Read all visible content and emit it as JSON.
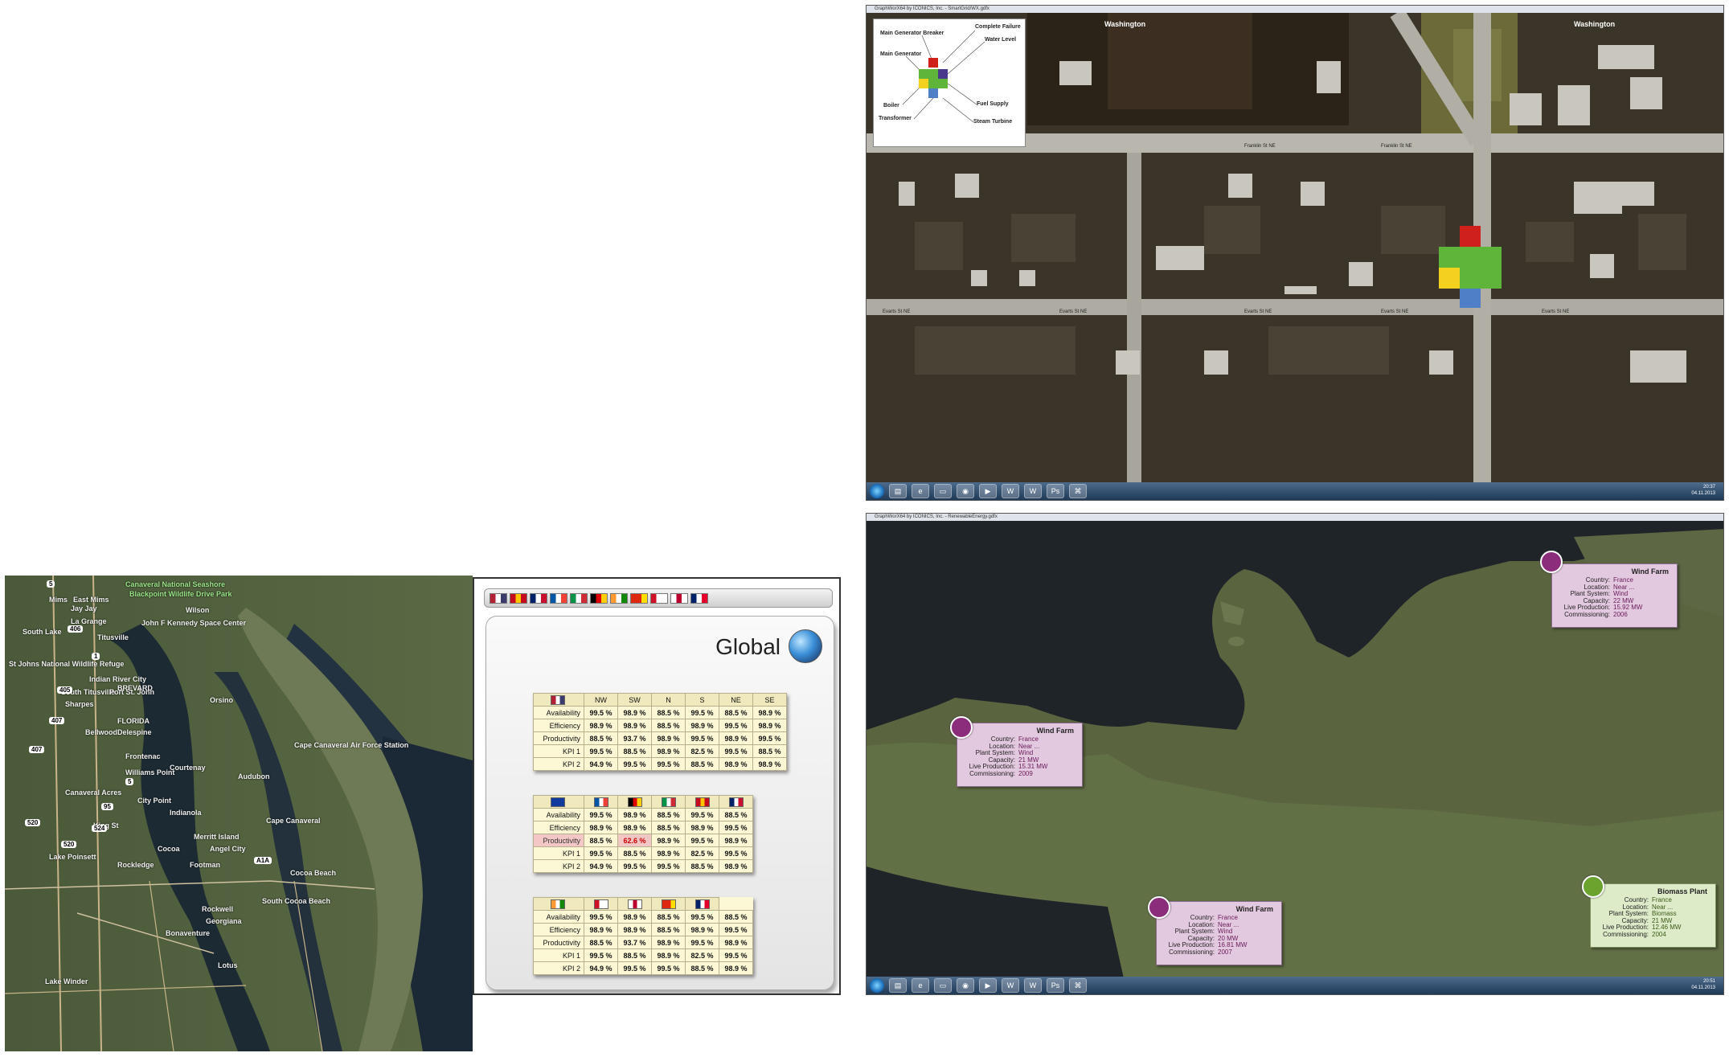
{
  "map_left": {
    "labels": [
      "Canaveral National Seashore",
      "Blackpoint Wildlife Drive Park",
      "John F Kennedy Space Center",
      "Titusville",
      "Mims",
      "East Mims",
      "Jay Jay",
      "La Grange",
      "South Lake",
      "St Johns National Wildlife Refuge",
      "Indian River City",
      "South Titusville",
      "Port St. John",
      "Sharpes",
      "Bellwood",
      "Delespine",
      "Frontenac",
      "Williams Point",
      "Courtenay",
      "Cape Canaveral Air Force Station",
      "Audubon",
      "Orsino",
      "Canaveral Acres",
      "City Point",
      "Indianola",
      "Cape Canaveral",
      "Merritt Island",
      "Angel City",
      "Cocoa",
      "Rockledge",
      "Lake Poinsett",
      "Footman",
      "Cocoa Beach",
      "South Cocoa Beach",
      "Rockwell",
      "Georgiana",
      "Bonaventure",
      "Lotus",
      "Lake Winder",
      "Wilson",
      "BREVARD",
      "FLORIDA",
      "King St"
    ],
    "shields": [
      "5",
      "406",
      "1",
      "405",
      "407",
      "407",
      "5",
      "95",
      "520",
      "524",
      "520",
      "A1A"
    ]
  },
  "dashboard": {
    "title": "Global",
    "flags": [
      {
        "name": "usa-flag",
        "colors": [
          "#b22234",
          "#ffffff",
          "#3c3b6e"
        ]
      },
      {
        "name": "spain-flag",
        "colors": [
          "#c60b1e",
          "#ffc400",
          "#c60b1e"
        ]
      },
      {
        "name": "uk-flag",
        "colors": [
          "#012169",
          "#ffffff",
          "#c8102e"
        ]
      },
      {
        "name": "france-flag",
        "colors": [
          "#0055a4",
          "#ffffff",
          "#ef4135"
        ]
      },
      {
        "name": "italy-flag",
        "colors": [
          "#009246",
          "#ffffff",
          "#ce2b37"
        ]
      },
      {
        "name": "germany-flag",
        "colors": [
          "#000000",
          "#dd0000",
          "#ffce00"
        ]
      },
      {
        "name": "india-flag",
        "colors": [
          "#ff9933",
          "#ffffff",
          "#138808"
        ]
      },
      {
        "name": "china-flag",
        "colors": [
          "#de2910",
          "#de2910",
          "#ffde00"
        ]
      },
      {
        "name": "indonesia-flag",
        "colors": [
          "#ce1126",
          "#ffffff",
          "#ffffff"
        ]
      },
      {
        "name": "japan-flag",
        "colors": [
          "#ffffff",
          "#bc002d",
          "#ffffff"
        ]
      },
      {
        "name": "australia-flag",
        "colors": [
          "#012169",
          "#ffffff",
          "#e4002b"
        ]
      }
    ],
    "tables": [
      {
        "header": [
          "NW",
          "SW",
          "N",
          "S",
          "NE",
          "SE"
        ],
        "header_flag": "usa-flag",
        "rows": [
          {
            "label": "Availability",
            "values": [
              "99.5 %",
              "98.9 %",
              "88.5 %",
              "99.5 %",
              "88.5 %",
              "98.9 %"
            ]
          },
          {
            "label": "Efficiency",
            "values": [
              "98.9 %",
              "98.9 %",
              "88.5 %",
              "98.9 %",
              "99.5 %",
              "98.9 %"
            ]
          },
          {
            "label": "Productivity",
            "values": [
              "88.5 %",
              "93.7 %",
              "98.9 %",
              "99.5 %",
              "98.9 %",
              "99.5 %"
            ]
          },
          {
            "label": "KPI 1",
            "values": [
              "99.5 %",
              "88.5 %",
              "98.9 %",
              "82.5 %",
              "99.5 %",
              "88.5 %"
            ]
          },
          {
            "label": "KPI 2",
            "values": [
              "94.9 %",
              "99.5 %",
              "99.5 %",
              "88.5 %",
              "98.9 %",
              "98.9 %"
            ]
          }
        ]
      },
      {
        "header_flags": [
          "eu-flag",
          "france-flag",
          "germany-flag",
          "italy-flag",
          "spain-flag",
          "uk-flag"
        ],
        "rows": [
          {
            "label": "Availability",
            "values": [
              "99.5 %",
              "98.9 %",
              "88.5 %",
              "99.5 %",
              "88.5 %"
            ]
          },
          {
            "label": "Efficiency",
            "values": [
              "98.9 %",
              "98.9 %",
              "88.5 %",
              "98.9 %",
              "99.5 %"
            ]
          },
          {
            "label": "Productivity",
            "values": [
              "88.5 %",
              "62.6 %",
              "98.9 %",
              "99.5 %",
              "98.9 %"
            ],
            "alert": true
          },
          {
            "label": "KPI 1",
            "values": [
              "99.5 %",
              "88.5 %",
              "98.9 %",
              "82.5 %",
              "99.5 %"
            ]
          },
          {
            "label": "KPI 2",
            "values": [
              "94.9 %",
              "99.5 %",
              "99.5 %",
              "88.5 %",
              "98.9 %"
            ]
          }
        ]
      },
      {
        "header_flags": [
          "india-flag",
          "indonesia-flag",
          "japan-flag",
          "china-flag",
          "australia-flag"
        ],
        "rows": [
          {
            "label": "Availability",
            "values": [
              "99.5 %",
              "98.9 %",
              "88.5 %",
              "99.5 %",
              "88.5 %"
            ]
          },
          {
            "label": "Efficiency",
            "values": [
              "98.9 %",
              "98.9 %",
              "88.5 %",
              "98.9 %",
              "99.5 %"
            ]
          },
          {
            "label": "Productivity",
            "values": [
              "88.5 %",
              "93.7 %",
              "98.9 %",
              "99.5 %",
              "98.9 %"
            ]
          },
          {
            "label": "KPI 1",
            "values": [
              "99.5 %",
              "88.5 %",
              "98.9 %",
              "82.5 %",
              "99.5 %"
            ]
          },
          {
            "label": "KPI 2",
            "values": [
              "94.9 %",
              "99.5 %",
              "99.5 %",
              "88.5 %",
              "98.9 %"
            ]
          }
        ]
      }
    ]
  },
  "smartgrid": {
    "window_title": "GraphWorX64 by ICONICS, Inc. - SmartGrid/WX.gdfx",
    "legend": {
      "labels": [
        "Main Generator Breaker",
        "Complete Failure",
        "Water Level",
        "Main Generator",
        "Boiler",
        "Fuel Supply",
        "Transformer",
        "Steam Turbine"
      ],
      "colors": {
        "red": "#d0201b",
        "green": "#5fb43a",
        "yellow": "#f2d21e",
        "blue": "#4f7fc6",
        "purple": "#4b3a8c"
      }
    },
    "streets": [
      "Washington",
      "Washington",
      "Franklin St NE",
      "Franklin St NE",
      "Franklin St NE",
      "Evarts St NE",
      "Evarts St NE",
      "Evarts St NE",
      "Evarts St NE",
      "Evarts St NE"
    ],
    "clock": [
      "20:37",
      "04.11.2013"
    ]
  },
  "renewable": {
    "window_title": "GraphWorX64 by ICONICS, Inc. - RenewableEnergy.gdfx",
    "field_labels": [
      "Country:",
      "Location:",
      "Plant System:",
      "Capacity:",
      "Live Production:",
      "Commissioning:"
    ],
    "plants": [
      {
        "title": "Wind Farm",
        "type": "wind",
        "country": "France",
        "location": "Near ...",
        "system": "Wind",
        "capacity": "22 MW",
        "live": "15.92 MW",
        "commissioning": "2006"
      },
      {
        "title": "Wind Farm",
        "type": "wind",
        "country": "France",
        "location": "Near ...",
        "system": "Wind",
        "capacity": "21 MW",
        "live": "15.31 MW",
        "commissioning": "2009"
      },
      {
        "title": "Wind Farm",
        "type": "wind",
        "country": "France",
        "location": "Near ...",
        "system": "Wind",
        "capacity": "20 MW",
        "live": "16.81 MW",
        "commissioning": "2007"
      },
      {
        "title": "Biomass Plant",
        "type": "bio",
        "country": "France",
        "location": "Near ...",
        "system": "Biomass",
        "capacity": "21 MW",
        "live": "12.46 MW",
        "commissioning": "2004"
      }
    ],
    "clock": [
      "20:51",
      "04.11.2013"
    ]
  },
  "taskbar_apps": [
    "explorer-icon",
    "ie-icon",
    "folder-icon",
    "chrome-icon",
    "media-icon",
    "word-icon",
    "word-icon",
    "photoshop-icon",
    "network-icon"
  ]
}
